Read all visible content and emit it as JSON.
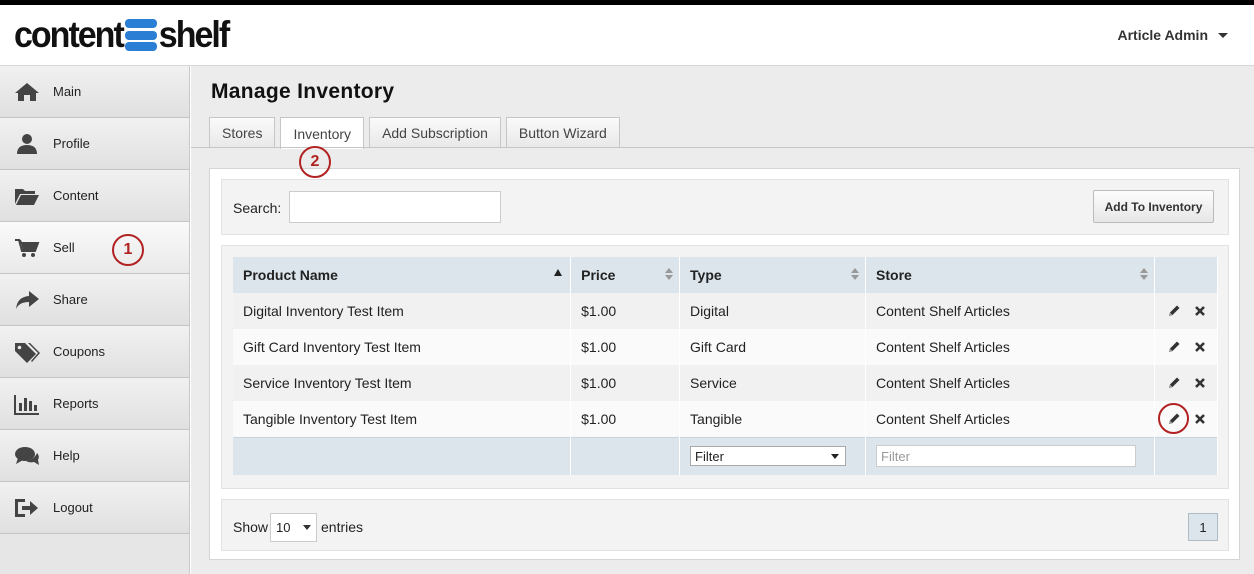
{
  "header": {
    "logo_left": "content",
    "logo_right": "shelf",
    "user_menu": "Article Admin"
  },
  "sidebar": {
    "items": [
      {
        "label": "Main",
        "icon": "home-icon"
      },
      {
        "label": "Profile",
        "icon": "user-icon"
      },
      {
        "label": "Content",
        "icon": "folder-open-icon"
      },
      {
        "label": "Sell",
        "icon": "shopping-cart-icon"
      },
      {
        "label": "Share",
        "icon": "share-icon"
      },
      {
        "label": "Coupons",
        "icon": "tags-icon"
      },
      {
        "label": "Reports",
        "icon": "bar-chart-icon"
      },
      {
        "label": "Help",
        "icon": "comments-icon"
      },
      {
        "label": "Logout",
        "icon": "sign-out-icon"
      }
    ],
    "active": "Sell"
  },
  "main": {
    "title": "Manage Inventory",
    "tabs": [
      "Stores",
      "Inventory",
      "Add Subscription",
      "Button Wizard"
    ],
    "active_tab": "Inventory",
    "search_label": "Search:",
    "search_value": "",
    "add_button": "Add To Inventory",
    "table": {
      "columns": [
        "Product Name",
        "Price",
        "Type",
        "Store"
      ],
      "rows": [
        {
          "name": "Digital Inventory Test Item",
          "price": "$1.00",
          "type": "Digital",
          "store": "Content Shelf Articles"
        },
        {
          "name": "Gift Card Inventory Test Item",
          "price": "$1.00",
          "type": "Gift Card",
          "store": "Content Shelf Articles"
        },
        {
          "name": "Service Inventory Test Item",
          "price": "$1.00",
          "type": "Service",
          "store": "Content Shelf Articles"
        },
        {
          "name": "Tangible Inventory Test Item",
          "price": "$1.00",
          "type": "Tangible",
          "store": "Content Shelf Articles"
        }
      ],
      "filter_type": "Filter",
      "filter_store_placeholder": "Filter"
    },
    "show_label": "Show",
    "page_size": "10",
    "entries_label": "entries",
    "page": "1"
  },
  "callouts": [
    "1",
    "2"
  ],
  "colors": {
    "accent": "#2a7fd4",
    "callout": "#b22222",
    "table_header": "#dce5eb"
  }
}
